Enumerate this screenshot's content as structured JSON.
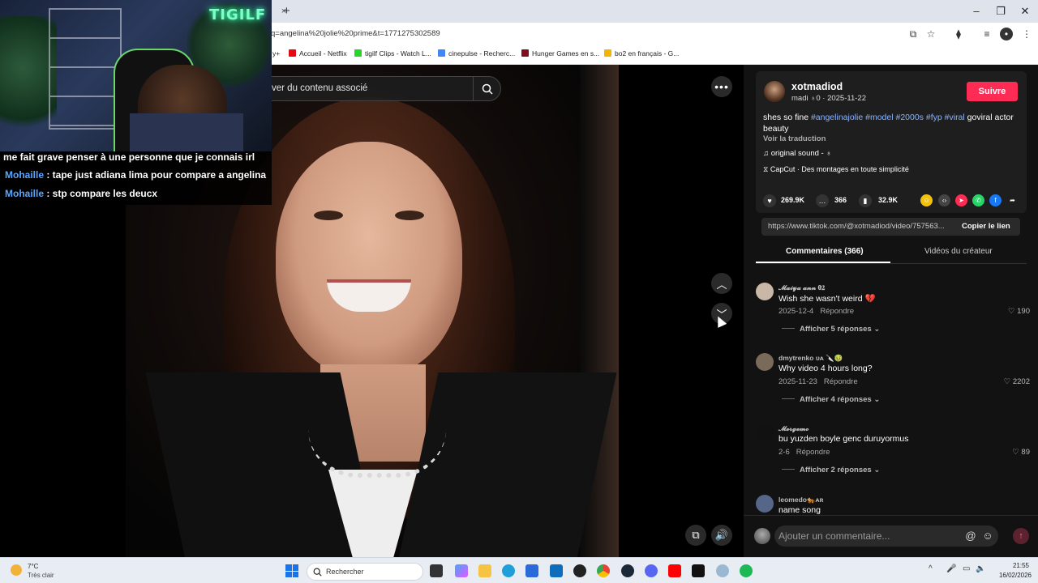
{
  "browser": {
    "url": "q=angelina%20jolie%20prime&t=1771275302589",
    "tab_close": "×",
    "tab_new": "+",
    "bookmarks": [
      {
        "label": "y+",
        "color": "#555"
      },
      {
        "label": "Accueil - Netflix",
        "color": "#e50914"
      },
      {
        "label": "tigilf Clips - Watch L...",
        "color": "#2bd42b"
      },
      {
        "label": "cinepulse - Recherc...",
        "color": "#4285f4"
      },
      {
        "label": "Hunger Games en s...",
        "color": "#7a1020"
      },
      {
        "label": "bo2 en français - G...",
        "color": "#f4b400"
      }
    ]
  },
  "stream": {
    "neon_sign": "TIGILF",
    "chat": [
      {
        "user": "",
        "text": "me fait grave penser à une personne que je connais irl"
      },
      {
        "user": "Mohaille",
        "text": " : tape just adiana lima pour compare a angelina"
      },
      {
        "user": "Mohaille",
        "text": " : stp compare les deucx"
      }
    ]
  },
  "video": {
    "search_text": "ver du contenu associé",
    "more_label": "•••",
    "prev_label": "︿",
    "next_label": "﹀"
  },
  "post": {
    "author": "xotmadiod",
    "author_meta": "madi ♁0 · 2025-11-22",
    "follow_label": "Suivre",
    "desc_plain_start": "shes so fine ",
    "tags": [
      "#angelinajolie",
      "#model",
      "#2000s",
      "#fyp",
      "#viral"
    ],
    "desc_plain_end": " goviral actor beauty",
    "translate_label": "Voir la traduction",
    "sound": "original sound - ♁",
    "capcut": "CapCut · Des montages en toute simplicité",
    "likes": "269.9K",
    "comments_count": "366",
    "saves": "32.9K",
    "link": "https://www.tiktok.com/@xotmadiod/video/757563...",
    "copy_label": "Copier le lien"
  },
  "tabs": {
    "comments": "Commentaires (366)",
    "creator_videos": "Vidéos du créateur"
  },
  "comments": [
    {
      "user": "𝓜𝓪𝓲𝔂𝓪 𝓪𝓷𝓷 𝟎𝟐",
      "text": "Wish she wasn't weird 💔",
      "date": "2025-12-4",
      "reply": "Répondre",
      "likes": "♡ 190",
      "more": "Afficher 5 réponses ⌄",
      "avatar": "#c9b8a8"
    },
    {
      "user": "dmytrenko ᴜᴀ 🔪🤢",
      "text": "Why video 4 hours long?",
      "date": "2025-11-23",
      "reply": "Répondre",
      "likes": "♡ 2202",
      "more": "Afficher 4 réponses ⌄",
      "avatar": "#7a6a5a"
    },
    {
      "user": "𝓜𝓮𝓻𝓰𝓮𝓶𝓸",
      "text": "bu yuzden boyle genc duruyormus",
      "date": "2-6",
      "reply": "Répondre",
      "likes": "♡ 89",
      "more": "Afficher 2 réponses ⌄",
      "avatar": "#111111"
    },
    {
      "user": "leomedo🐅ᴀʀ",
      "text": "name song",
      "date": "",
      "reply": "",
      "likes": "",
      "more": "",
      "avatar": "#556688"
    }
  ],
  "comment_bar": {
    "placeholder": "Ajouter un commentaire...",
    "at_icon": "@",
    "emoji_icon": "☺",
    "send_icon": "↑"
  },
  "taskbar": {
    "temp": "7°C",
    "weather": "Très clair",
    "search": "Rechercher",
    "time": "21:55",
    "date": "16/02/2026"
  }
}
